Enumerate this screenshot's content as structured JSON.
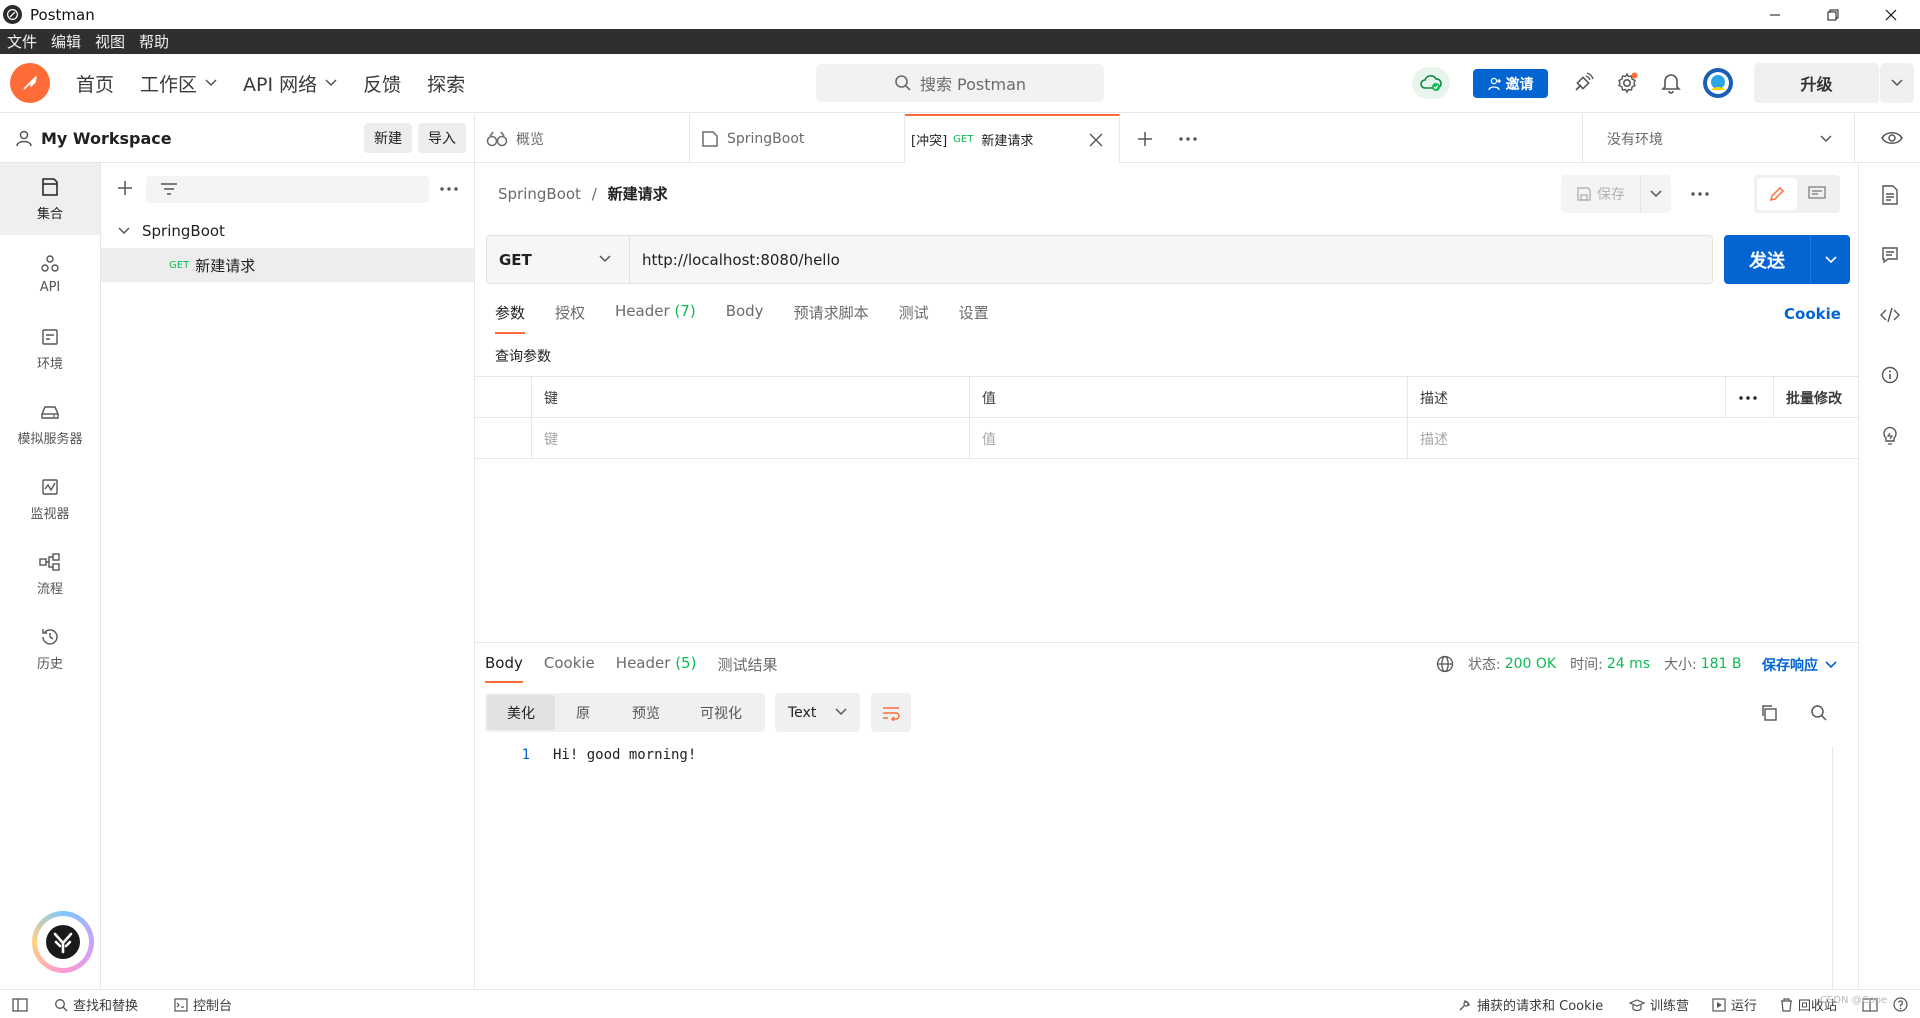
{
  "window": {
    "title": "Postman",
    "minimize": "—",
    "maximize": "❐",
    "close": "✕"
  },
  "menu": [
    "文件",
    "编辑",
    "视图",
    "帮助"
  ],
  "header": {
    "nav": [
      {
        "label": "首页",
        "dropdown": false
      },
      {
        "label": "工作区",
        "dropdown": true
      },
      {
        "label": "API 网络",
        "dropdown": true
      },
      {
        "label": "反馈",
        "dropdown": false
      },
      {
        "label": "探索",
        "dropdown": false
      }
    ],
    "search_placeholder": "搜索 Postman",
    "invite_label": "邀请",
    "upgrade_label": "升级"
  },
  "workspace": {
    "name": "My Workspace",
    "new_label": "新建",
    "import_label": "导入"
  },
  "rail": [
    {
      "label": "集合",
      "icon": "collections-icon",
      "active": true
    },
    {
      "label": "API",
      "icon": "api-icon",
      "active": false
    },
    {
      "label": "环境",
      "icon": "environments-icon",
      "active": false
    },
    {
      "label": "模拟服务器",
      "icon": "mock-server-icon",
      "active": false
    },
    {
      "label": "监视器",
      "icon": "monitor-icon",
      "active": false
    },
    {
      "label": "流程",
      "icon": "flows-icon",
      "active": false
    },
    {
      "label": "历史",
      "icon": "history-icon",
      "active": false
    }
  ],
  "sidebar": {
    "collection": "SpringBoot",
    "request": {
      "method": "GET",
      "name": "新建请求"
    }
  },
  "tabs": [
    {
      "label": "概览",
      "icon": "overview-icon"
    },
    {
      "label": "SpringBoot",
      "icon": "collection-icon"
    },
    {
      "conflict": "[冲突]",
      "method": "GET",
      "label": "新建请求",
      "close": "✕"
    }
  ],
  "environment": {
    "selected": "没有环境"
  },
  "request": {
    "breadcrumb_parent": "SpringBoot",
    "breadcrumb_sep": "/",
    "breadcrumb_current": "新建请求",
    "save_label": "保存",
    "method": "GET",
    "url": "http://localhost:8080/hello",
    "send_label": "发送",
    "tabs": [
      {
        "label": "参数",
        "count": ""
      },
      {
        "label": "授权",
        "count": ""
      },
      {
        "label": "Header",
        "count": "(7)"
      },
      {
        "label": "Body",
        "count": ""
      },
      {
        "label": "预请求脚本",
        "count": ""
      },
      {
        "label": "测试",
        "count": ""
      },
      {
        "label": "设置",
        "count": ""
      }
    ],
    "cookie_label": "Cookie",
    "params_title": "查询参数",
    "params_headers": {
      "key": "键",
      "value": "值",
      "desc": "描述",
      "bulk": "批量修改"
    },
    "params_placeholders": {
      "key": "键",
      "value": "值",
      "desc": "描述"
    }
  },
  "response": {
    "tabs": [
      {
        "label": "Body",
        "count": ""
      },
      {
        "label": "Cookie",
        "count": ""
      },
      {
        "label": "Header",
        "count": "(5)"
      },
      {
        "label": "测试结果",
        "count": ""
      }
    ],
    "status_label": "状态:",
    "status_value": "200 OK",
    "time_label": "时间:",
    "time_value": "24 ms",
    "size_label": "大小:",
    "size_value": "181 B",
    "save_label": "保存响应",
    "formats": [
      "美化",
      "原",
      "预览",
      "可视化"
    ],
    "active_format": "美化",
    "language": "Text",
    "body_lines": [
      {
        "n": "1",
        "text": "Hi! good morning!"
      }
    ]
  },
  "statusbar": {
    "find_replace": "查找和替换",
    "console": "控制台",
    "capture": "捕获的请求和 Cookie",
    "bootcamp": "训练营",
    "runner": "运行",
    "trash": "回收站",
    "watermark": "CSDN @Cope"
  },
  "colors": {
    "accent": "#ff6c37",
    "primary": "#0265d2",
    "success": "#0cbb52"
  }
}
